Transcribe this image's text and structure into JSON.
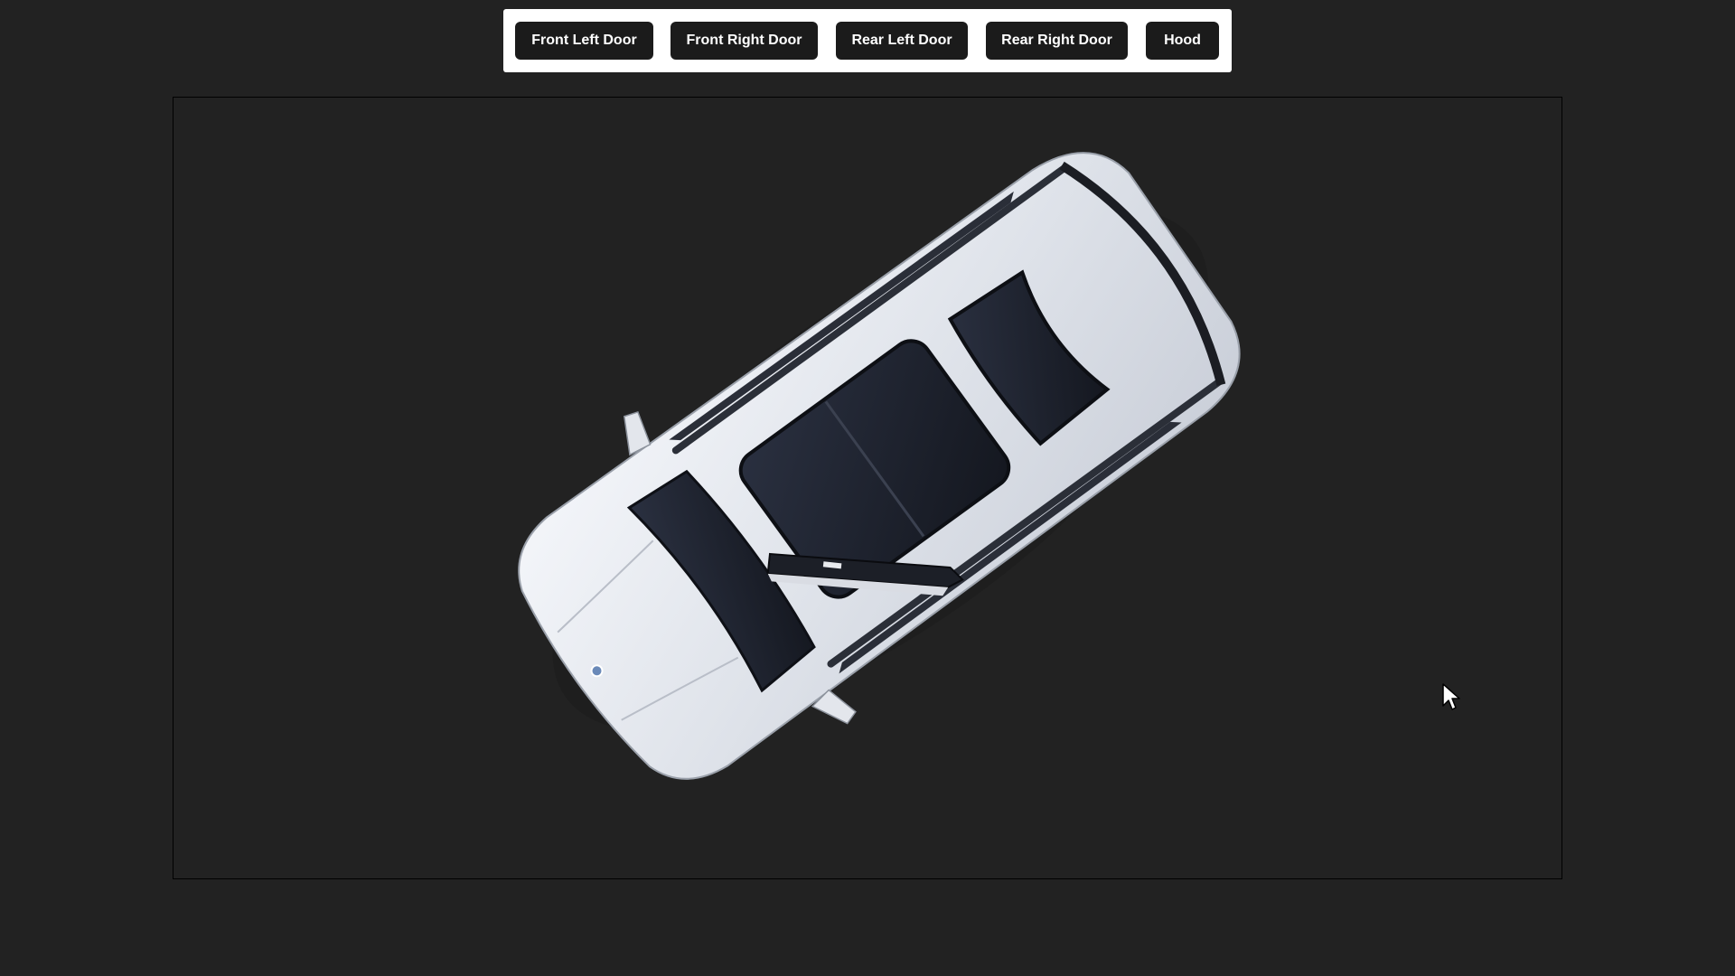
{
  "toolbar": {
    "buttons": [
      {
        "label": "Front Left Door"
      },
      {
        "label": "Front Right Door"
      },
      {
        "label": "Rear Left Door"
      },
      {
        "label": "Rear Right Door"
      },
      {
        "label": "Hood"
      }
    ]
  },
  "viewer": {
    "model": "car-3d-top-view-icon",
    "open_part": "front-left-door"
  },
  "colors": {
    "background": "#222222",
    "toolbar_bg": "#ffffff",
    "button_bg": "#1b1b1b",
    "button_text": "#ffffff",
    "car_body": "#e9ebf0",
    "glass": "#1e2230"
  }
}
